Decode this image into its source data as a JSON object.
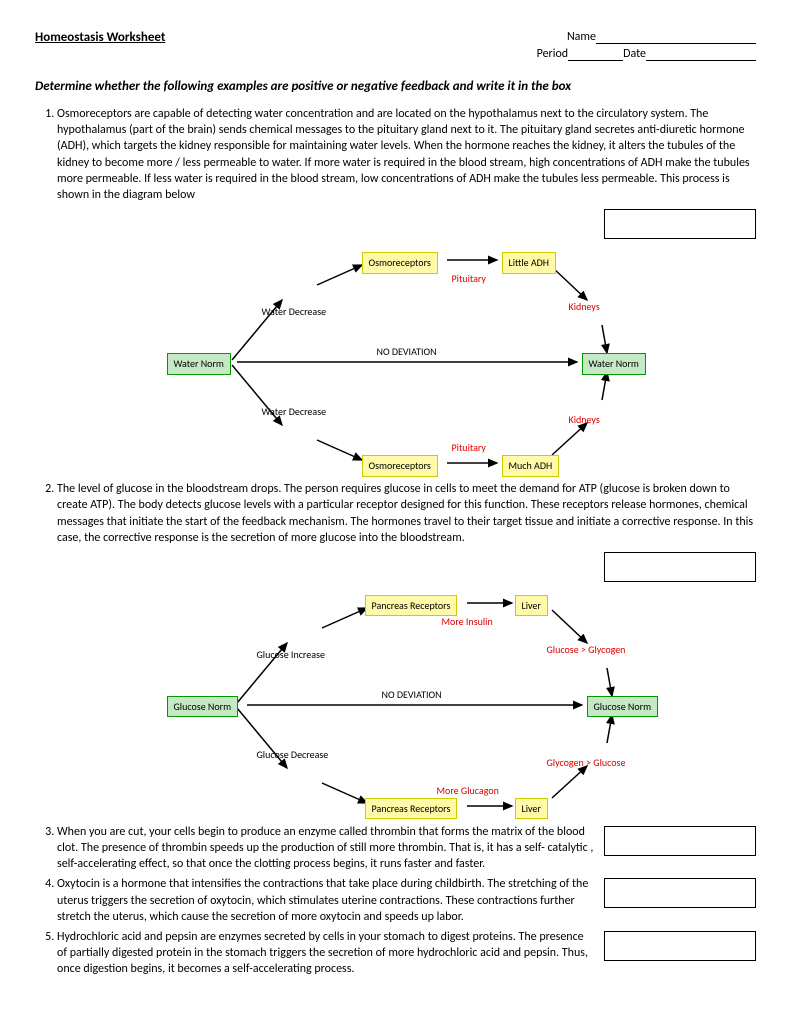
{
  "header": {
    "title": "Homeostasis Worksheet",
    "name_label": "Name",
    "period_label": "Period",
    "date_label": "Date"
  },
  "instructions": "Determine whether the following examples are positive or negative feedback and write it in the box",
  "questions": {
    "q1": "Osmoreceptors are capable of detecting water concentration and are located on the hypothalamus next to the circulatory system. The hypothalamus (part of the brain) sends chemical messages to the pituitary gland next to it. The pituitary gland secretes anti-diuretic hormone (ADH), which targets the kidney responsible for maintaining water levels. When the hormone reaches the kidney, it alters the tubules of the kidney to become more / less permeable to water. If more water is required in the blood stream, high concentrations of ADH make the tubules more permeable. If less water is required in the blood stream, low concentrations of ADH make the tubules less permeable. This process is shown in the diagram below",
    "q2": "The level of glucose in the bloodstream drops. The person requires glucose in cells to meet the demand for ATP (glucose is broken down to create ATP). The body detects glucose levels with a particular receptor designed for this function. These receptors release hormones, chemical messages that initiate the start of the feedback mechanism. The hormones travel to their target tissue and initiate a corrective response. In this case, the corrective response is the secretion of more glucose into the bloodstream.",
    "q3": "When you are cut, your cells begin to produce an enzyme called thrombin that forms the matrix of the blood clot. The presence of thrombin speeds up the production of still more thrombin. That is, it has a self- catalytic , self-accelerating effect, so that once the clotting process begins, it runs faster and faster.",
    "q4": "Oxytocin is a hormone that intensifies the contractions that take place during childbirth. The stretching of the uterus triggers the secretion of oxytocin, which stimulates uterine contractions. These contractions further stretch the uterus, which cause the secretion of more oxytocin and speeds up labor.",
    "q5": "Hydrochloric acid and pepsin are enzymes secreted by cells in your stomach to digest proteins. The presence of partially digested protein in the stomach triggers the secretion of more hydrochloric acid and pepsin. Thus, once digestion begins, it becomes a self-accelerating process."
  },
  "diagram1": {
    "water_norm": "Water Norm",
    "osmoreceptors": "Osmoreceptors",
    "little_adh": "Little ADH",
    "much_adh": "Much ADH",
    "water_decrease": "Water Decrease",
    "pituitary": "Pituitary",
    "kidneys": "Kidneys",
    "no_deviation": "NO DEVIATION"
  },
  "diagram2": {
    "glucose_norm": "Glucose Norm",
    "pancreas_receptors": "Pancreas Receptors",
    "liver": "Liver",
    "glucose_increase": "Glucose Increase",
    "glucose_decrease": "Glucose Decrease",
    "more_insulin": "More Insulin",
    "more_glucagon": "More Glucagon",
    "glucose_glycogen": "Glucose > Glycogen",
    "glycogen_glucose": "Glycogen > Glucose",
    "no_deviation": "NO DEVIATION"
  }
}
